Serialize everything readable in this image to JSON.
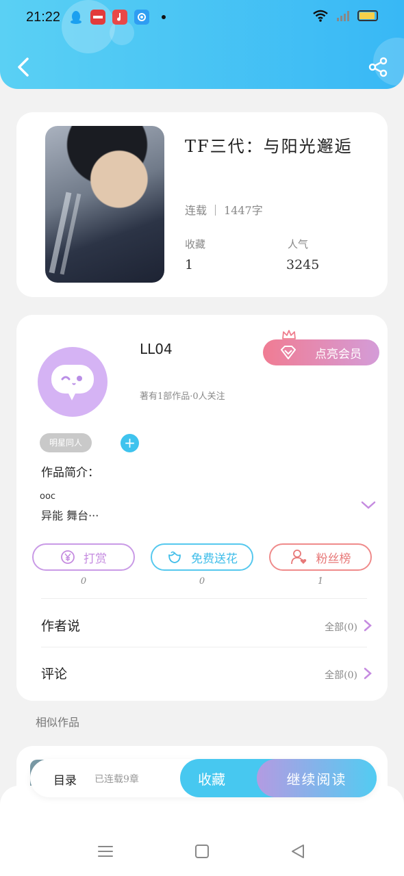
{
  "status_bar": {
    "time": "21:22",
    "icons": [
      "qq-icon",
      "xiaohongshu-icon",
      "music-icon",
      "camera-icon",
      "notification-dot-icon",
      "wifi-icon",
      "signal-icon",
      "battery-icon"
    ]
  },
  "header": {
    "back_icon": "chevron-left-icon",
    "share_icon": "share-icon",
    "gradient": [
      "#5ad0f4",
      "#38b8f5"
    ]
  },
  "book": {
    "title": "TF三代：与阳光邂逅",
    "status": "连载",
    "word_count": "1447字",
    "stats": [
      {
        "label": "收藏",
        "value": "1"
      },
      {
        "label": "人气",
        "value": "3245"
      }
    ]
  },
  "author": {
    "name": "LL04",
    "meta": "著有1部作品·0人关注",
    "vip_label": "点亮会员",
    "tag": "明星同人",
    "add_tag_label": "+",
    "intro_label": "作品简介：",
    "intro_lines": [
      "ooc",
      "异能 舞台···"
    ],
    "actions": [
      {
        "label": "打赏",
        "count": "0",
        "icon": "yuan-coin-icon",
        "color": "#c58be0"
      },
      {
        "label": "免费送花",
        "count": "0",
        "icon": "flower-icon",
        "color": "#3fbde9"
      },
      {
        "label": "粉丝榜",
        "count": "1",
        "icon": "fan-person-icon",
        "color": "#e77878"
      }
    ],
    "rows": [
      {
        "label": "作者说",
        "right": "全部(0)"
      },
      {
        "label": "评论",
        "right": "全部(0)"
      }
    ]
  },
  "similar": {
    "label": "相似作品"
  },
  "bottom_bar": {
    "toc_label": "目录",
    "chapter_info": "已连载9章",
    "favorite_label": "收藏",
    "read_label": "继续阅读"
  },
  "nav": {
    "icons": [
      "menu-icon",
      "home-icon",
      "back-triangle-icon"
    ]
  }
}
